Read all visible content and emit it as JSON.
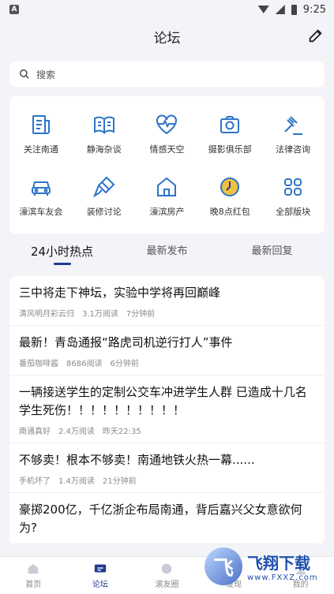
{
  "statusbar": {
    "time": "9:25",
    "badge": "A"
  },
  "header": {
    "title": "论坛"
  },
  "search": {
    "placeholder": "搜索"
  },
  "grid": [
    {
      "label": "关注南通",
      "icon": "newspaper-icon"
    },
    {
      "label": "静海杂谈",
      "icon": "book-icon"
    },
    {
      "label": "情感天空",
      "icon": "heart-pulse-icon"
    },
    {
      "label": "摄影俱乐部",
      "icon": "camera-icon"
    },
    {
      "label": "法律咨询",
      "icon": "gavel-icon"
    },
    {
      "label": "濠滨车友会",
      "icon": "car-icon"
    },
    {
      "label": "装修讨论",
      "icon": "paintbrush-icon"
    },
    {
      "label": "濠滨房产",
      "icon": "house-icon"
    },
    {
      "label": "晚8点红包",
      "icon": "clock-icon"
    },
    {
      "label": "全部版块",
      "icon": "grid-icon"
    }
  ],
  "tabs": [
    "24小时热点",
    "最新发布",
    "最新回复"
  ],
  "posts": [
    {
      "title": "三中将走下神坛，实验中学将再回巅峰",
      "author": "清风明月彩云归",
      "reads": "3.1万阅读",
      "time": "7分钟前"
    },
    {
      "title": "最新！青岛通报“路虎司机逆行打人”事件",
      "author": "番茄咖啡酱",
      "reads": "8686阅读",
      "time": "6分钟前"
    },
    {
      "title": "一辆接送学生的定制公交车冲进学生人群 已造成十几名学生死伤！！！！！！！！！！",
      "author": "南通真好",
      "reads": "2.4万阅读",
      "time": "昨天22:35"
    },
    {
      "title": "不够卖！根本不够卖！南通地铁火热一幕......",
      "author": "手机坏了",
      "reads": "1.4万阅读",
      "time": "21分钟前"
    },
    {
      "title": "豪掷200亿，千亿浙企布局南通，背后嘉兴父女意欲何为?",
      "author": "",
      "reads": "",
      "time": ""
    }
  ],
  "tabbar": [
    {
      "label": "首页",
      "icon": "home-icon"
    },
    {
      "label": "论坛",
      "icon": "forum-icon"
    },
    {
      "label": "滚友圈",
      "icon": "circle-icon"
    },
    {
      "label": "发现",
      "icon": "discover-icon"
    },
    {
      "label": "我的",
      "icon": "me-icon"
    }
  ],
  "watermark": {
    "text": "飞翔下载",
    "sub": "www.FXXZ.com"
  },
  "colors": {
    "accent": "#1f3a8f",
    "icon": "#2d74c8",
    "background": "#f3f4f8"
  }
}
